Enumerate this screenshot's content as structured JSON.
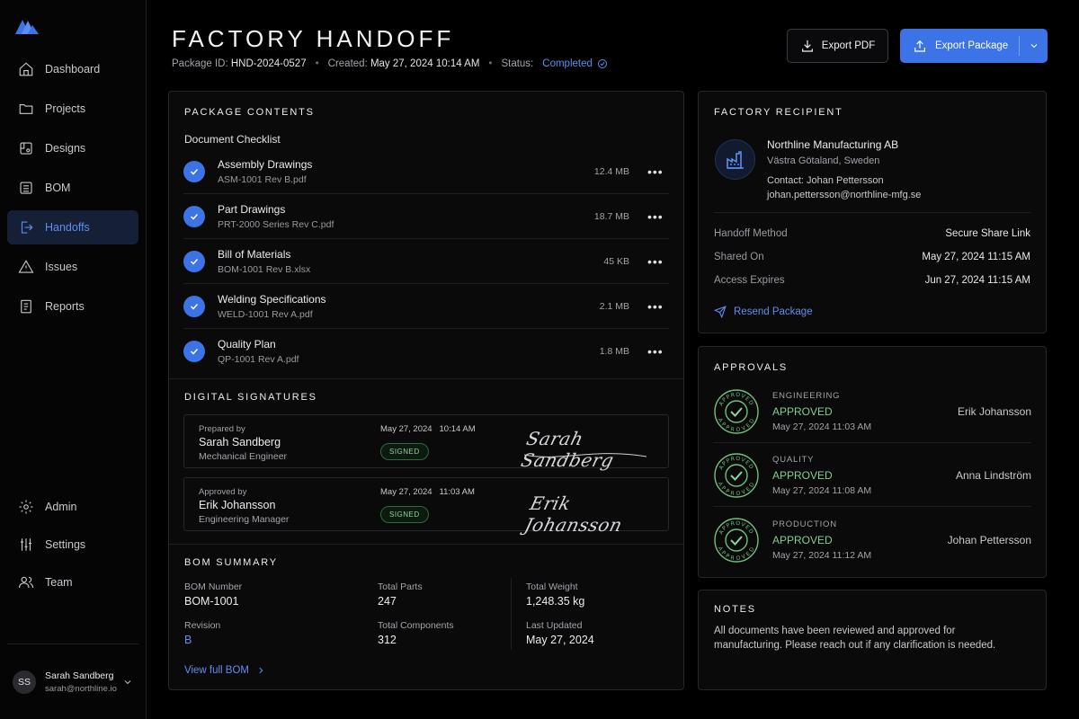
{
  "sidebar": {
    "items": [
      {
        "label": "Dashboard",
        "icon": "home-icon"
      },
      {
        "label": "Projects",
        "icon": "folder-icon"
      },
      {
        "label": "Designs",
        "icon": "design-icon"
      },
      {
        "label": "BOM",
        "icon": "list-icon"
      },
      {
        "label": "Handoffs",
        "icon": "handoff-icon",
        "active": true
      },
      {
        "label": "Issues",
        "icon": "warning-icon"
      },
      {
        "label": "Reports",
        "icon": "report-icon"
      }
    ],
    "bottom_items": [
      {
        "label": "Admin",
        "icon": "gear-icon"
      },
      {
        "label": "Settings",
        "icon": "sliders-icon"
      },
      {
        "label": "Team",
        "icon": "users-icon"
      }
    ],
    "user": {
      "initials": "SS",
      "name": "Sarah Sandberg",
      "email": "sarah@northline.io"
    }
  },
  "header": {
    "title": "FACTORY HANDOFF",
    "package_id_label": "Package ID:",
    "package_id": "HND-2024-0527",
    "created_label": "Created:",
    "created": "May 27, 2024 10:14 AM",
    "status_label": "Status:",
    "status": "Completed",
    "export_pdf": "Export PDF",
    "export_package": "Export Package"
  },
  "package": {
    "title": "PACKAGE CONTENTS",
    "checklist_title": "Document Checklist",
    "documents": [
      {
        "name": "Assembly Drawings",
        "file": "ASM-1001 Rev B.pdf",
        "size": "12.4 MB"
      },
      {
        "name": "Part Drawings",
        "file": "PRT-2000 Series Rev C.pdf",
        "size": "18.7 MB"
      },
      {
        "name": "Bill of Materials",
        "file": "BOM-1001 Rev B.xlsx",
        "size": "45 KB"
      },
      {
        "name": "Welding Specifications",
        "file": "WELD-1001 Rev A.pdf",
        "size": "2.1 MB"
      },
      {
        "name": "Quality Plan",
        "file": "QP-1001 Rev A.pdf",
        "size": "1.8 MB"
      }
    ]
  },
  "signatures": {
    "title": "DIGITAL SIGNATURES",
    "items": [
      {
        "role": "Prepared by",
        "name": "Sarah Sandberg",
        "position": "Mechanical Engineer",
        "date": "May 27, 2024",
        "time": "10:14 AM",
        "badge": "SIGNED",
        "signature": "Sarah Sandberg"
      },
      {
        "role": "Approved by",
        "name": "Erik Johansson",
        "position": "Engineering Manager",
        "date": "May 27, 2024",
        "time": "11:03 AM",
        "badge": "SIGNED",
        "signature": "Erik Johansson"
      }
    ]
  },
  "bom": {
    "title": "BOM SUMMARY",
    "bom_number_label": "BOM Number",
    "bom_number": "BOM-1001",
    "revision_label": "Revision",
    "revision": "B",
    "total_parts_label": "Total Parts",
    "total_parts": "247",
    "total_components_label": "Total Components",
    "total_components": "312",
    "total_weight_label": "Total Weight",
    "total_weight": "1,248.35 kg",
    "last_updated_label": "Last Updated",
    "last_updated": "May 27, 2024",
    "view_link": "View full BOM"
  },
  "recipient": {
    "title": "FACTORY RECIPIENT",
    "company": "Northline Manufacturing AB",
    "location": "Västra Götaland, Sweden",
    "contact": "Contact: Johan Pettersson",
    "email": "johan.pettersson@northline-mfg.se",
    "rows": [
      {
        "label": "Handoff Method",
        "value": "Secure Share Link"
      },
      {
        "label": "Shared On",
        "value": "May 27, 2024 11:15 AM"
      },
      {
        "label": "Access Expires",
        "value": "Jun 27, 2024 11:15 AM"
      }
    ],
    "resend": "Resend Package"
  },
  "approvals": {
    "title": "APPROVALS",
    "stamp_text": "APPROVED",
    "items": [
      {
        "category": "ENGINEERING",
        "status": "APPROVED",
        "time": "May 27, 2024 11:03 AM",
        "name": "Erik Johansson"
      },
      {
        "category": "QUALITY",
        "status": "APPROVED",
        "time": "May 27, 2024 11:08 AM",
        "name": "Anna Lindström"
      },
      {
        "category": "PRODUCTION",
        "status": "APPROVED",
        "time": "May 27, 2024 11:12 AM",
        "name": "Johan Pettersson"
      }
    ]
  },
  "notes": {
    "title": "NOTES",
    "text": "All documents have been reviewed and approved for manufacturing. Please reach out if any clarification is needed."
  },
  "colors": {
    "accent": "#3c74e8",
    "success": "#7fd08c",
    "background": "#000000"
  }
}
